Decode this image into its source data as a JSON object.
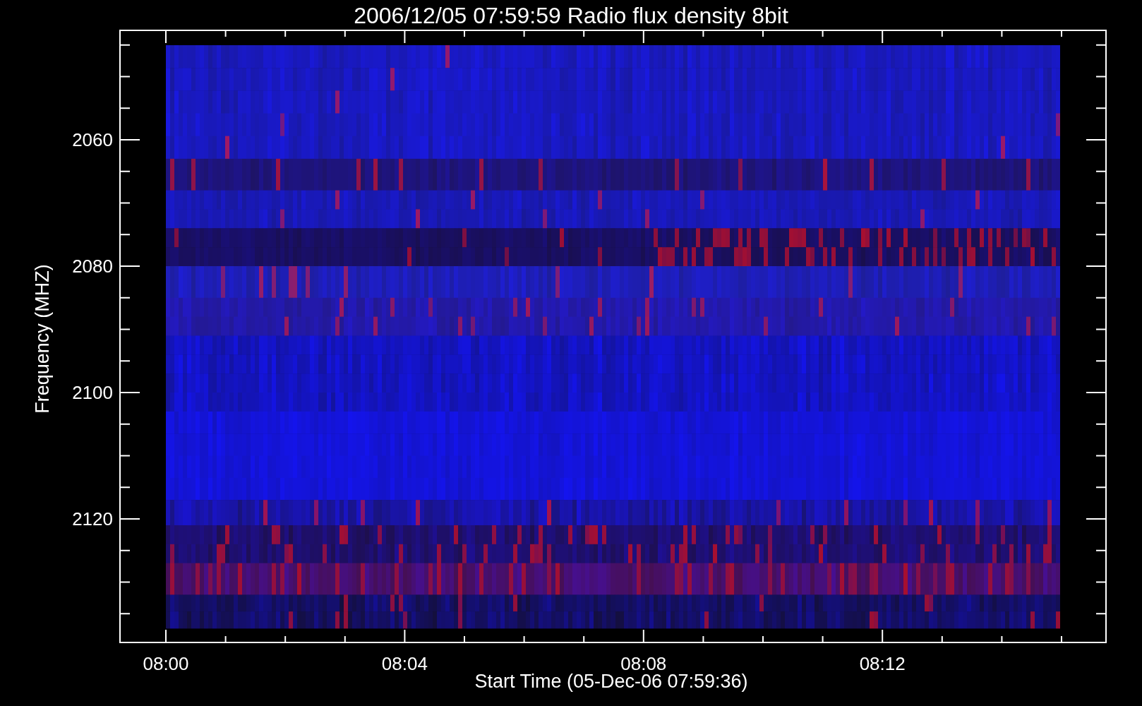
{
  "plot": {
    "title": "2006/12/05 07:59:59 Radio flux density 8bit",
    "y_axis": {
      "label": "Frequency (MHZ)",
      "ticks": [
        "2060",
        "2080",
        "2100",
        "2120"
      ]
    },
    "x_axis": {
      "label": "Start Time (05-Dec-06 07:59:36)",
      "ticks": [
        "08:00",
        "08:04",
        "08:08",
        "08:12"
      ]
    }
  }
}
